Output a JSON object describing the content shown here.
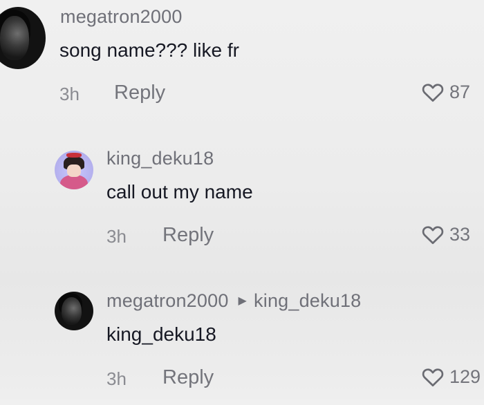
{
  "comments": [
    {
      "username": "megatron2000",
      "text": "song name??? like fr",
      "time": "3h",
      "reply_label": "Reply",
      "likes": "87",
      "avatar_icon": "dark-portrait-avatar"
    },
    {
      "username": "king_deku18",
      "text": "call out my name",
      "time": "3h",
      "reply_label": "Reply",
      "likes": "33",
      "avatar_icon": "anime-character-avatar"
    },
    {
      "username": "megatron2000",
      "reply_to": "king_deku18",
      "text": "king_deku18",
      "time": "3h",
      "reply_label": "Reply",
      "likes": "129",
      "avatar_icon": "dark-portrait-avatar"
    }
  ],
  "colors": {
    "background": "#ececec",
    "username": "#6f7078",
    "body_text": "#161823",
    "meta": "#8a8b91"
  },
  "icons": {
    "like": "heart-outline-icon",
    "reply_arrow": "triangle-right-icon"
  }
}
